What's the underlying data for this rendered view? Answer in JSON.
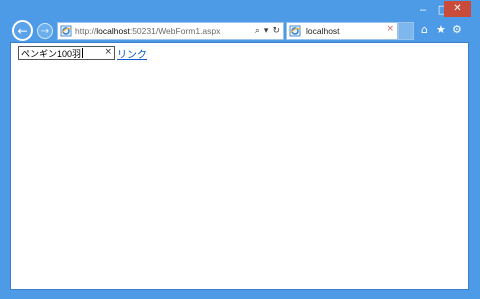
{
  "window": {
    "minimize": "‒",
    "maximize": "□",
    "close": "✕"
  },
  "nav": {
    "back_icon": "←",
    "forward_icon": "→",
    "url_prefix": "http://",
    "url_host": "localhost",
    "url_rest": ":50231/WebForm1.aspx",
    "search_icon": "⌕",
    "dropdown_icon": "▾",
    "refresh_icon": "↻"
  },
  "tab": {
    "title": "localhost",
    "close_icon": "×"
  },
  "toolbar": {
    "home_icon": "⌂",
    "favorites_icon": "★",
    "settings_icon": "⚙"
  },
  "page": {
    "search_value": "ペンギン100羽",
    "clear_icon": "×",
    "link_text": "リンク"
  }
}
